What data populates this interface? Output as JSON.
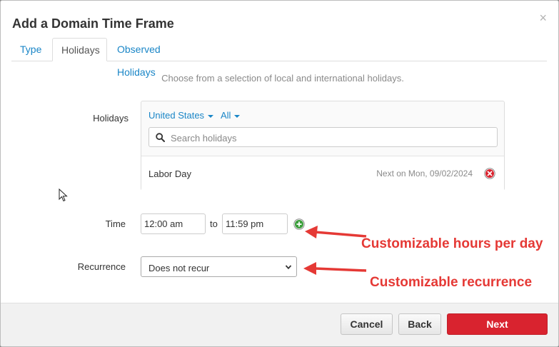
{
  "dialog": {
    "title": "Add a Domain Time Frame",
    "close": "×"
  },
  "tabs": [
    {
      "label": "Type"
    },
    {
      "label": "Holidays"
    },
    {
      "label": "Observed Holidays"
    }
  ],
  "hint": "Choose from a selection of local and international holidays.",
  "holidays": {
    "label": "Holidays",
    "country": "United States",
    "filter": "All",
    "search_placeholder": "Search holidays",
    "items": [
      {
        "name": "Labor Day",
        "next": "Next on Mon, 09/02/2024"
      }
    ]
  },
  "time": {
    "label": "Time",
    "start": "12:00 am",
    "separator": "to",
    "end": "11:59 pm"
  },
  "recurrence": {
    "label": "Recurrence",
    "value": "Does not recur"
  },
  "annotations": {
    "hours": "Customizable hours per day",
    "recurrence": "Customizable recurrence"
  },
  "footer": {
    "cancel": "Cancel",
    "back": "Back",
    "next": "Next"
  },
  "colors": {
    "link": "#1a86c7",
    "primary": "#d9232f",
    "annotation": "#e53935",
    "add": "#3c9e3c",
    "remove": "#d9232f"
  }
}
